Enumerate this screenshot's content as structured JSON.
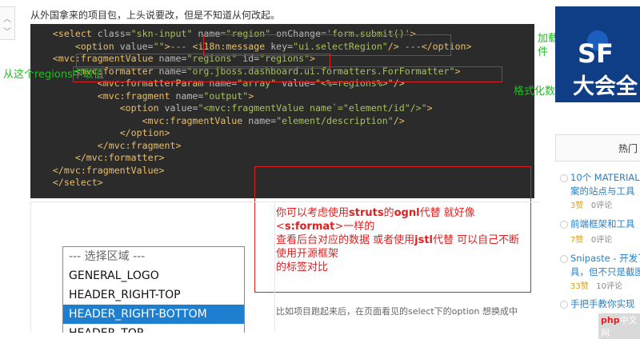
{
  "intro_text": "从外国拿来的项目包，上头说要改，但是不知道从何改起。",
  "code_lines": [
    {
      "parts": [
        [
          "    ",
          "p"
        ],
        [
          "<select",
          "t"
        ],
        [
          " class=",
          "a"
        ],
        [
          "\"skn-input\"",
          "v"
        ],
        [
          " name=",
          "a"
        ],
        [
          "\"region\"",
          "v"
        ],
        [
          " onChange=",
          "a"
        ],
        [
          "'form.submit()'",
          "v"
        ],
        [
          ">",
          "t"
        ]
      ]
    },
    {
      "parts": [
        [
          "        ",
          "p"
        ],
        [
          "<option",
          "t"
        ],
        [
          " value=",
          "a"
        ],
        [
          "\"\"",
          "v"
        ],
        [
          ">",
          "t"
        ],
        [
          "--- ",
          "p"
        ],
        [
          "<i18n:message",
          "t"
        ],
        [
          " key=",
          "a"
        ],
        [
          "\"ui.selectRegion\"",
          "v"
        ],
        [
          "/>",
          "t"
        ],
        [
          " ---",
          "p"
        ],
        [
          "</option>",
          "t"
        ]
      ]
    },
    {
      "parts": [
        [
          "    ",
          "p"
        ],
        [
          "<mvc:fragmentValue",
          "t"
        ],
        [
          " name=",
          "a"
        ],
        [
          "\"regions\"",
          "v"
        ],
        [
          " id=",
          "a"
        ],
        [
          "\"regions\"",
          "v"
        ],
        [
          ">",
          "t"
        ]
      ]
    },
    {
      "parts": [
        [
          "        ",
          "p"
        ],
        [
          "<mvc:formatter",
          "t"
        ],
        [
          " name=",
          "a"
        ],
        [
          "\"org.jboss.dashboard.ui.formatters.ForFormatter\"",
          "v"
        ],
        [
          ">",
          "t"
        ]
      ]
    },
    {
      "parts": [
        [
          "            ",
          "p"
        ],
        [
          "<mvc:formatterParam",
          "t"
        ],
        [
          " name=",
          "a"
        ],
        [
          "\"array\"",
          "v"
        ],
        [
          " value=",
          "a"
        ],
        [
          "\"<%=regions%>\"",
          "v"
        ],
        [
          "/>",
          "t"
        ]
      ]
    },
    {
      "parts": [
        [
          "            ",
          "p"
        ],
        [
          "<mvc:fragment",
          "t"
        ],
        [
          " name=",
          "a"
        ],
        [
          "\"output\"",
          "v"
        ],
        [
          ">",
          "t"
        ]
      ]
    },
    {
      "parts": [
        [
          "                ",
          "p"
        ],
        [
          "<option",
          "t"
        ],
        [
          " value=",
          "a"
        ],
        [
          "\"<mvc:fragmentValue name`=\"element/id\"/>\"",
          "v"
        ],
        [
          ">",
          "t"
        ]
      ]
    },
    {
      "parts": [
        [
          "                    ",
          "p"
        ],
        [
          "<mvc:fragmentValue",
          "t"
        ],
        [
          " name=",
          "a"
        ],
        [
          "\"element/description\"",
          "v"
        ],
        [
          "/>",
          "t"
        ]
      ]
    },
    {
      "parts": [
        [
          "                ",
          "p"
        ],
        [
          "</option>",
          "t"
        ]
      ]
    },
    {
      "parts": [
        [
          "            ",
          "p"
        ],
        [
          "</mvc:fragment>",
          "t"
        ]
      ]
    },
    {
      "parts": [
        [
          "        ",
          "p"
        ],
        [
          "</mvc:formatter>",
          "t"
        ]
      ]
    },
    {
      "parts": [
        [
          "    ",
          "p"
        ],
        [
          "</mvc:fragmentValue>",
          "t"
        ]
      ]
    },
    {
      "parts": [
        [
          "    ",
          "p"
        ],
        [
          "</select>",
          "t"
        ]
      ]
    }
  ],
  "annotations": {
    "load_i18n": "加载国际化资源文件",
    "regions_value": "从这个regions中取值",
    "format_data": "格式化数据"
  },
  "note": {
    "line1_a": "你可以考虑使用",
    "line1_b": "struts",
    "line1_c": "的",
    "line1_d": "ognl",
    "line1_e": "代替 就好像<",
    "line1_f": "s:format",
    "line1_g": ">一样的",
    "line2": "查看后台对应的数据 或者使用",
    "line2_b": "jstl",
    "line2_c": "代替 可以自己不断 使用开源框架",
    "line3": "的标签对比"
  },
  "after_text": "比如项目跑起来后，在页面看见的select下的option 想换成中",
  "listbox": {
    "options": [
      "--- 选择区域 ---",
      "GENERAL_LOGO",
      "HEADER_RIGHT-TOP",
      "HEADER_RIGHT-BOTTOM",
      "HEADER_TOP"
    ],
    "selected_index": 3
  },
  "sidebar": {
    "ad_big": "SF",
    "ad_cn": "大会全",
    "hot_label": "热门",
    "items": [
      {
        "title_line1": "10个 MATERIAL",
        "title_line2": "案的站点与工具",
        "likes": "3赞",
        "comments": "0评论"
      },
      {
        "title_line1": "前端框架和工具",
        "title_line2": "",
        "likes": "7赞",
        "comments": "0评论"
      },
      {
        "title_line1": "Snipaste - 开发了",
        "title_line2": "具，但不只是截图",
        "likes": "33赞",
        "comments": "10评论"
      },
      {
        "title_line1": "手把手教你实现",
        "title_line2": "",
        "likes": "",
        "comments": ""
      }
    ]
  },
  "watermark": {
    "logo": "php",
    "text": "中文网"
  }
}
